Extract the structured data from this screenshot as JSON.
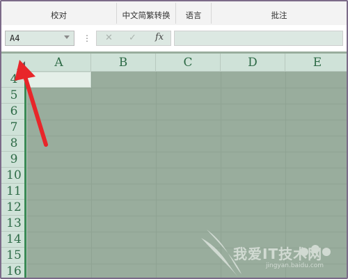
{
  "ribbon": {
    "groups": [
      {
        "label": "校对"
      },
      {
        "label": "中文简繁转换"
      },
      {
        "label": "语言"
      },
      {
        "label": "批注"
      }
    ]
  },
  "formula_bar": {
    "name_box_value": "A4",
    "function_label": "fx",
    "formula_value": ""
  },
  "grid": {
    "columns": [
      "A",
      "B",
      "C",
      "D",
      "E"
    ],
    "rows": [
      "4",
      "5",
      "6",
      "7",
      "8",
      "9",
      "10",
      "11",
      "12",
      "13",
      "14",
      "15",
      "16"
    ],
    "active_cell": "A4"
  },
  "annotation": {
    "arrow_color": "#e8262a"
  },
  "watermark": {
    "text": "我爱IT技术网",
    "url": "jingyan.baidu.com"
  }
}
